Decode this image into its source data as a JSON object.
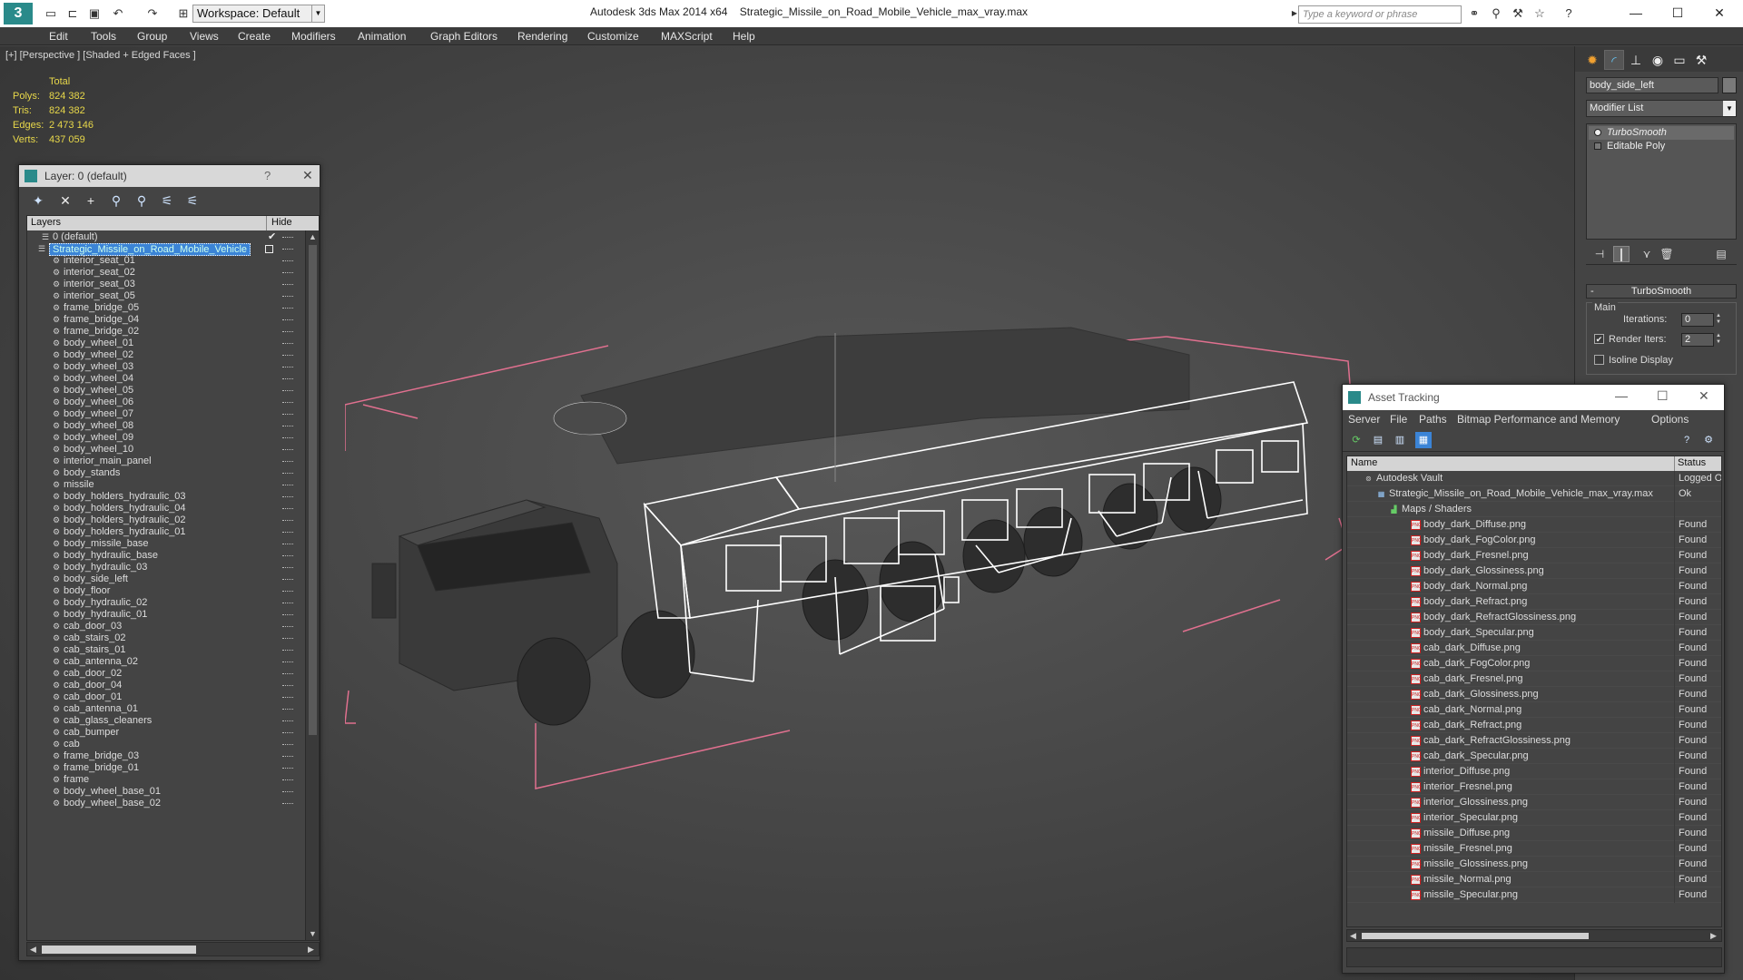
{
  "titlebar": {
    "workspace": "Workspace: Default",
    "app_name": "Autodesk 3ds Max  2014 x64",
    "file_name": "Strategic_Missile_on_Road_Mobile_Vehicle_max_vray.max",
    "search_placeholder": "Type a keyword or phrase"
  },
  "menu": [
    "Edit",
    "Tools",
    "Group",
    "Views",
    "Create",
    "Modifiers",
    "Animation",
    "Graph Editors",
    "Rendering",
    "Customize",
    "MAXScript",
    "Help"
  ],
  "viewport": {
    "label": "[+] [Perspective ] [Shaded + Edged Faces ]",
    "stats": {
      "header": "Total",
      "rows": [
        {
          "label": "Polys:",
          "value": "824 382"
        },
        {
          "label": "Tris:",
          "value": "824 382"
        },
        {
          "label": "Edges:",
          "value": "2 473 146"
        },
        {
          "label": "Verts:",
          "value": "437 059"
        }
      ]
    }
  },
  "layer_panel": {
    "title": "Layer: 0 (default)",
    "help": "?",
    "col_layers": "Layers",
    "col_hide": "Hide",
    "default_layer": "0 (default)",
    "selected_layer": "Strategic_Missile_on_Road_Mobile_Vehicle",
    "objects": [
      "interior_seat_01",
      "interior_seat_02",
      "interior_seat_03",
      "interior_seat_05",
      "frame_bridge_05",
      "frame_bridge_04",
      "frame_bridge_02",
      "body_wheel_01",
      "body_wheel_02",
      "body_wheel_03",
      "body_wheel_04",
      "body_wheel_05",
      "body_wheel_06",
      "body_wheel_07",
      "body_wheel_08",
      "body_wheel_09",
      "body_wheel_10",
      "interior_main_panel",
      "body_stands",
      "missile",
      "body_holders_hydraulic_03",
      "body_holders_hydraulic_04",
      "body_holders_hydraulic_02",
      "body_holders_hydraulic_01",
      "body_missile_base",
      "body_hydraulic_base",
      "body_hydraulic_03",
      "body_side_left",
      "body_floor",
      "body_hydraulic_02",
      "body_hydraulic_01",
      "cab_door_03",
      "cab_stairs_02",
      "cab_stairs_01",
      "cab_antenna_02",
      "cab_door_02",
      "cab_door_04",
      "cab_door_01",
      "cab_antenna_01",
      "cab_glass_cleaners",
      "cab_bumper",
      "cab",
      "frame_bridge_03",
      "frame_bridge_01",
      "frame",
      "body_wheel_base_01",
      "body_wheel_base_02"
    ]
  },
  "command_panel": {
    "object_name": "body_side_left",
    "modifier_list": "Modifier List",
    "stack": [
      "TurboSmooth",
      "Editable Poly"
    ],
    "rollout_title": "TurboSmooth",
    "group_main": "Main",
    "iterations_label": "Iterations:",
    "iterations_value": "0",
    "render_iters_label": "Render Iters:",
    "render_iters_value": "2",
    "render_iters_checked": true,
    "isoline_label": "Isoline Display",
    "isoline_checked": false
  },
  "asset_panel": {
    "title": "Asset Tracking",
    "menu": [
      "Server",
      "File",
      "Paths",
      "Bitmap Performance and Memory",
      "Options"
    ],
    "col_name": "Name",
    "col_status": "Status",
    "vault": {
      "name": "Autodesk Vault",
      "status": "Logged O"
    },
    "file": {
      "name": "Strategic_Missile_on_Road_Mobile_Vehicle_max_vray.max",
      "status": "Ok"
    },
    "maps_group": "Maps / Shaders",
    "maps": [
      {
        "name": "body_dark_Diffuse.png",
        "status": "Found"
      },
      {
        "name": "body_dark_FogColor.png",
        "status": "Found"
      },
      {
        "name": "body_dark_Fresnel.png",
        "status": "Found"
      },
      {
        "name": "body_dark_Glossiness.png",
        "status": "Found"
      },
      {
        "name": "body_dark_Normal.png",
        "status": "Found"
      },
      {
        "name": "body_dark_Refract.png",
        "status": "Found"
      },
      {
        "name": "body_dark_RefractGlossiness.png",
        "status": "Found"
      },
      {
        "name": "body_dark_Specular.png",
        "status": "Found"
      },
      {
        "name": "cab_dark_Diffuse.png",
        "status": "Found"
      },
      {
        "name": "cab_dark_FogColor.png",
        "status": "Found"
      },
      {
        "name": "cab_dark_Fresnel.png",
        "status": "Found"
      },
      {
        "name": "cab_dark_Glossiness.png",
        "status": "Found"
      },
      {
        "name": "cab_dark_Normal.png",
        "status": "Found"
      },
      {
        "name": "cab_dark_Refract.png",
        "status": "Found"
      },
      {
        "name": "cab_dark_RefractGlossiness.png",
        "status": "Found"
      },
      {
        "name": "cab_dark_Specular.png",
        "status": "Found"
      },
      {
        "name": "interior_Diffuse.png",
        "status": "Found"
      },
      {
        "name": "interior_Fresnel.png",
        "status": "Found"
      },
      {
        "name": "interior_Glossiness.png",
        "status": "Found"
      },
      {
        "name": "interior_Specular.png",
        "status": "Found"
      },
      {
        "name": "missile_Diffuse.png",
        "status": "Found"
      },
      {
        "name": "missile_Fresnel.png",
        "status": "Found"
      },
      {
        "name": "missile_Glossiness.png",
        "status": "Found"
      },
      {
        "name": "missile_Normal.png",
        "status": "Found"
      },
      {
        "name": "missile_Specular.png",
        "status": "Found"
      }
    ]
  },
  "colors": {
    "stats_text": "#e8d84a",
    "selection": "#3b84d6",
    "bounding_box": "#e0708f",
    "wireframe": "#ffffff",
    "viewport_bg": "#444444"
  }
}
